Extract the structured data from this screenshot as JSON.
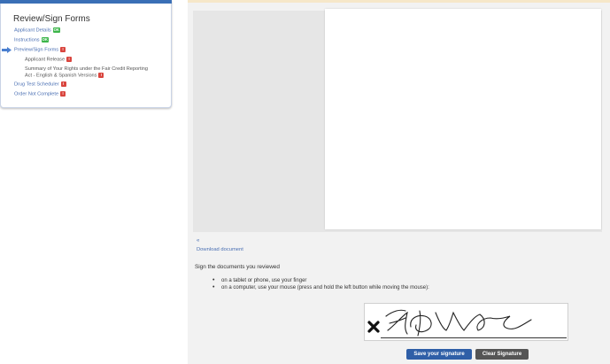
{
  "nav": {
    "title": "Review/Sign Forms",
    "items": [
      {
        "label": "Applicant Details",
        "badge": "OK"
      },
      {
        "label": "Instructions",
        "badge": "OK"
      },
      {
        "label": "Preview/Sign Forms",
        "badge": "!"
      },
      {
        "label": "Applicant Release",
        "badge": "!"
      },
      {
        "label": "Summary of Your Rights under the Fair Credit Reporting",
        "label2": "Act - English & Spanish Versions",
        "badge": "!"
      },
      {
        "label": "Drug Test Scheduler",
        "badge": "!"
      },
      {
        "label": "Order Not Complete",
        "badge": "!"
      }
    ]
  },
  "document": {
    "nav_arrow": "«",
    "download_label": "Download document"
  },
  "sign": {
    "heading": "Sign the documents you reviewed",
    "instructions": [
      "on a tablet or phone, use your finger",
      "on a computer, use your mouse (press and hold the left button while moving the mouse):"
    ],
    "save_label": "Save your signature",
    "clear_label": "Clear Signature"
  },
  "colors": {
    "accent": "#3a6fb6",
    "ok": "#3cb54a",
    "error": "#d9453e",
    "save_button": "#2f5fa7",
    "clear_button": "#555555"
  },
  "icons": [
    "arrow-right-icon",
    "signature-x-icon"
  ]
}
